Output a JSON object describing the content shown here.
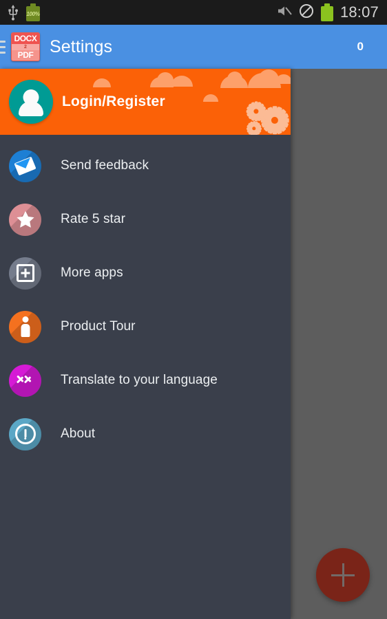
{
  "status_bar": {
    "usb_icon": "usb-icon",
    "battery_charging_icon": "battery-charging-icon",
    "battery_percent": "100%",
    "mute_icon": "volume-mute-icon",
    "dnd_icon": "do-not-disturb-icon",
    "battery_icon": "battery-icon",
    "time": "18:07",
    "background_color": "#1b1b1b"
  },
  "app_bar": {
    "menu_icon": "hamburger-menu-icon",
    "app_icon": {
      "name": "docx2pdf-app-icon",
      "top_text": "DOCX",
      "mid_text": "2",
      "bottom_text": "PDF"
    },
    "title": "Settings",
    "counter": "0",
    "background_color": "#4a90e2"
  },
  "drawer": {
    "background_color": "#3a3f4b",
    "header": {
      "avatar_icon": "user-avatar-icon",
      "avatar_color": "#009b94",
      "title": "Login/Register",
      "background_color": "#fb6107",
      "decoration": "clouds-and-gears"
    },
    "items": [
      {
        "label": "Send feedback",
        "icon": "envelope-icon",
        "icon_color": "#1d7fd4"
      },
      {
        "label": "Rate 5 star",
        "icon": "star-icon",
        "icon_color": "#dd8f95"
      },
      {
        "label": "More apps",
        "icon": "square-plus-icon",
        "icon_color": "#757c8c"
      },
      {
        "label": "Product Tour",
        "icon": "person-icon",
        "icon_color": "#f4711f"
      },
      {
        "label": "Translate to your language",
        "icon": "double-chevron-icon",
        "icon_color": "#d51ad5"
      },
      {
        "label": "About",
        "icon": "exclamation-circle-icon",
        "icon_color": "#5ba7c6"
      }
    ]
  },
  "background": {
    "scrim_color": "#5d5d5d",
    "fab": {
      "icon": "plus-icon",
      "color": "#7a2418"
    }
  }
}
